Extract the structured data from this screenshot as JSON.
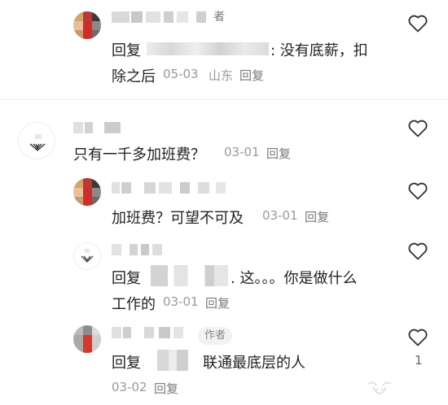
{
  "comments": [
    {
      "text1": "回复",
      "text2": ": 没有底薪，扣",
      "text3": "除之后",
      "date": "05-03",
      "location": "山东",
      "reply_label": "回复",
      "name_tail": "者"
    },
    {
      "text": "只有一千多加班费？",
      "date": "03-01",
      "reply_label": "回复"
    },
    {
      "text": "加班费？可望不可及",
      "date": "03-01",
      "reply_label": "回复"
    },
    {
      "text1a": "回复",
      "text1b": ". 这。。。你是做什么",
      "text2": "工作的",
      "date": "03-01",
      "reply_label": "回复"
    },
    {
      "badge": "作者",
      "text1a": "回复",
      "text1b": "联通最底层的人",
      "date": "03-02",
      "reply_label": "回复",
      "like_count": "1"
    }
  ]
}
